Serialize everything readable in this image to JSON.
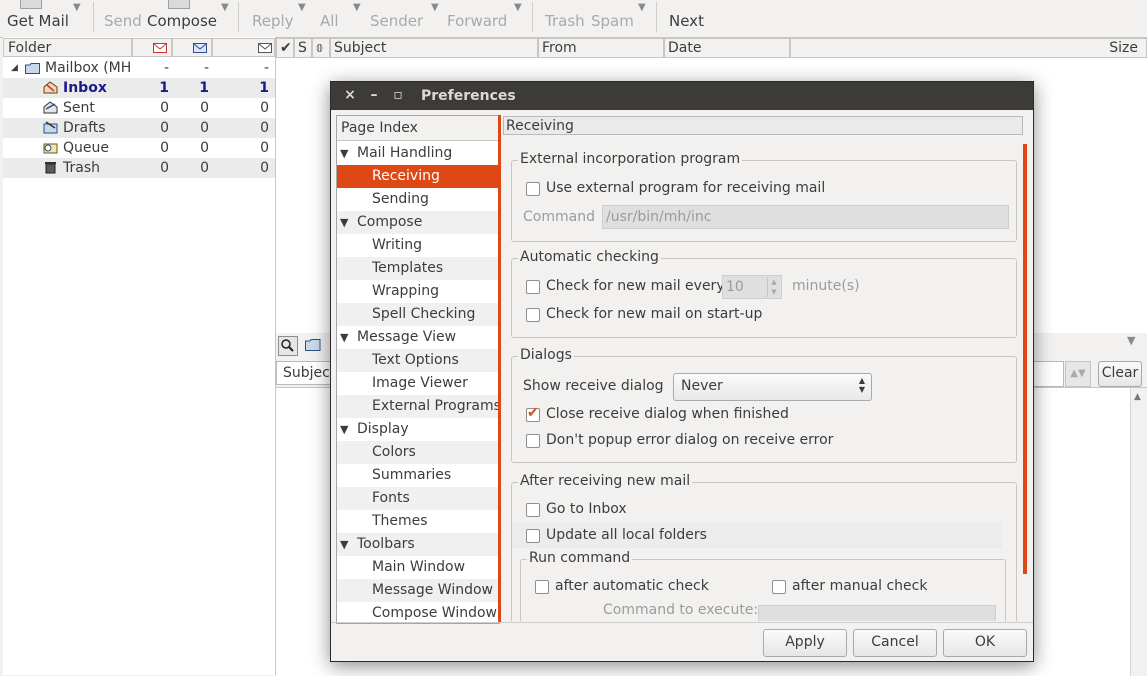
{
  "toolbar": {
    "get_mail": "Get Mail",
    "send": "Send",
    "compose": "Compose",
    "reply": "Reply",
    "all": "All",
    "sender": "Sender",
    "forward": "Forward",
    "trash": "Trash",
    "spam": "Spam",
    "next": "Next"
  },
  "folder_pane": {
    "column_folder": "Folder",
    "mailbox": "Mailbox (MH",
    "rows": [
      {
        "name": "Inbox",
        "new": "1",
        "unread": "1",
        "total": "1"
      },
      {
        "name": "Sent",
        "new": "0",
        "unread": "0",
        "total": "0"
      },
      {
        "name": "Drafts",
        "new": "0",
        "unread": "0",
        "total": "0"
      },
      {
        "name": "Queue",
        "new": "0",
        "unread": "0",
        "total": "0"
      },
      {
        "name": "Trash",
        "new": "0",
        "unread": "0",
        "total": "0"
      }
    ],
    "mailbox_counts": [
      "-",
      "-",
      "-"
    ]
  },
  "message_list": {
    "col_s": "S",
    "col_subject": "Subject",
    "col_from": "From",
    "col_date": "Date",
    "col_size": "Size"
  },
  "search_bar": {
    "subject_label": "Subject",
    "clear": "Clear"
  },
  "dialog": {
    "title": "Preferences",
    "page_index_header": "Page Index",
    "page_index": [
      {
        "label": "Mail Handling",
        "parent": true
      },
      {
        "label": "Receiving",
        "parent": false,
        "selected": true
      },
      {
        "label": "Sending",
        "parent": false
      },
      {
        "label": "Compose",
        "parent": true
      },
      {
        "label": "Writing",
        "parent": false
      },
      {
        "label": "Templates",
        "parent": false
      },
      {
        "label": "Wrapping",
        "parent": false
      },
      {
        "label": "Spell Checking",
        "parent": false
      },
      {
        "label": "Message View",
        "parent": true
      },
      {
        "label": "Text Options",
        "parent": false
      },
      {
        "label": "Image Viewer",
        "parent": false
      },
      {
        "label": "External Programs",
        "parent": false
      },
      {
        "label": "Display",
        "parent": true
      },
      {
        "label": "Colors",
        "parent": false
      },
      {
        "label": "Summaries",
        "parent": false
      },
      {
        "label": "Fonts",
        "parent": false
      },
      {
        "label": "Themes",
        "parent": false
      },
      {
        "label": "Toolbars",
        "parent": true
      },
      {
        "label": "Main Window",
        "parent": false
      },
      {
        "label": "Message Window",
        "parent": false
      },
      {
        "label": "Compose Window",
        "parent": false
      }
    ],
    "content_header": "Receiving",
    "external": {
      "title": "External incorporation program",
      "use_external": "Use external program for receiving mail",
      "command_label": "Command",
      "command_value": "/usr/bin/mh/inc"
    },
    "automatic": {
      "title": "Automatic checking",
      "check_every": "Check for new mail every",
      "interval": "10",
      "unit": "minute(s)",
      "check_startup": "Check for new mail on start-up"
    },
    "dialogs": {
      "title": "Dialogs",
      "show_label": "Show receive dialog",
      "show_value": "Never",
      "close_when_finished": "Close receive dialog when finished",
      "no_popup_error": "Don't popup error dialog on receive error"
    },
    "after": {
      "title": "After receiving new mail",
      "go_inbox": "Go to Inbox",
      "update_folders": "Update all local folders",
      "run_command": "Run command",
      "after_auto": "after automatic check",
      "after_manual": "after manual check",
      "command_to_execute": "Command to execute:"
    },
    "buttons": {
      "apply": "Apply",
      "cancel": "Cancel",
      "ok": "OK"
    }
  },
  "colors": {
    "accent": "#dd4814",
    "titlebar": "#3c3b37",
    "inbox_text": "#1a1a8c"
  }
}
